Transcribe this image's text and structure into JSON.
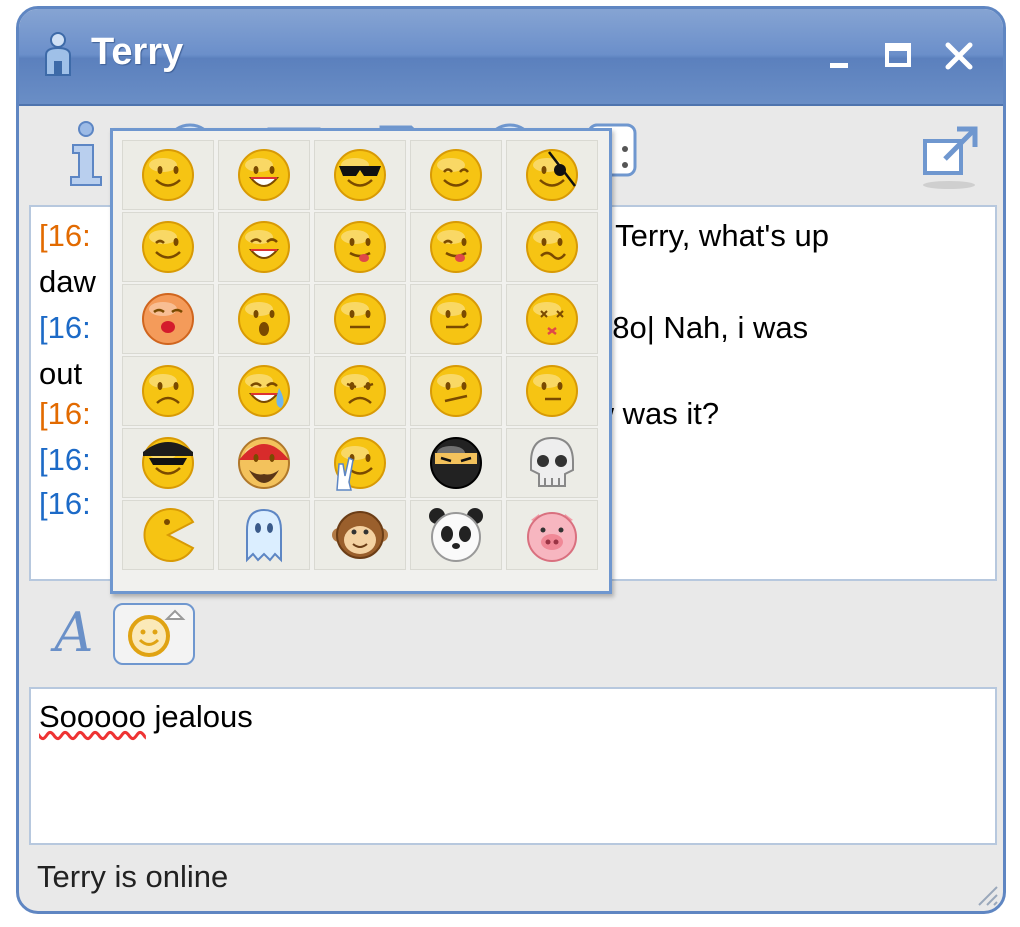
{
  "window": {
    "title": "Terry"
  },
  "chat": {
    "lines": [
      {
        "timestamp": "[16:",
        "text": ": Hey Terry, what's up",
        "ts_color": "orange"
      },
      {
        "timestamp": "",
        "text": "daw",
        "ts_color": "none"
      },
      {
        "timestamp": "[16:",
        "text": "ude!! 8o| Nah, i was",
        "ts_color": "blue"
      },
      {
        "timestamp": "",
        "text": "out",
        "ts_color": "none"
      },
      {
        "timestamp": "[16:",
        "text": ": How was it?",
        "ts_color": "orange"
      },
      {
        "timestamp": "[16:",
        "text": "",
        "ts_color": "blue"
      },
      {
        "timestamp": "[16:",
        "text": "",
        "ts_color": "blue"
      }
    ]
  },
  "input": {
    "misspelled": "Sooooo",
    "rest": " jealous"
  },
  "status": {
    "text": "Terry is online"
  },
  "formatting": {
    "font_label": "A"
  },
  "emoticons": [
    "smile",
    "grin",
    "cool-sunglasses",
    "happy",
    "pirate",
    "wink",
    "big-grin",
    "tongue-out",
    "tongue-wink",
    "confused",
    "kiss",
    "surprised",
    "straight-face",
    "smirk",
    "dizzy",
    "sad",
    "crying",
    "frown",
    "unsure",
    "meh",
    "cool-dude",
    "bearded-cap",
    "peace",
    "ninja",
    "skull",
    "pacman",
    "ghost",
    "monkey",
    "panda",
    "pig"
  ],
  "colors": {
    "title_bar": "#6b8fca",
    "timestamp_orange": "#e26a00",
    "timestamp_blue": "#1c6ac7",
    "border_blue": "#6f97cf"
  }
}
